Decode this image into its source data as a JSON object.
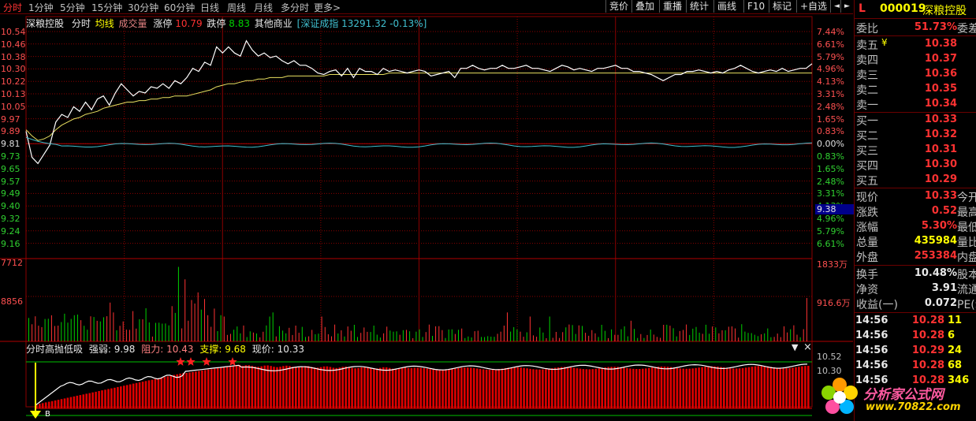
{
  "toolbar": {
    "periods": [
      "分时",
      "1分钟",
      "5分钟",
      "15分钟",
      "30分钟",
      "60分钟",
      "日线",
      "周线",
      "月线",
      "多分时",
      "更多"
    ],
    "more_arrow": ">",
    "buttons": [
      "竞价",
      "叠加",
      "重播",
      "统计",
      "画线",
      "F10",
      "标记",
      "+自选"
    ],
    "scroll_left": "◄",
    "scroll_right": "►"
  },
  "chart_header": {
    "stock": "深粮控股",
    "mode": "分时",
    "avg": "均线",
    "volume": "成交量",
    "limit_up_label": "涨停",
    "limit_up": "10.79",
    "limit_down_label": "跌停",
    "limit_down": "8.83",
    "sector": "其他商业",
    "index": "[深证成指 13291.32 -0.13%]"
  },
  "price_axis": [
    "10.54",
    "10.46",
    "10.38",
    "10.30",
    "10.22",
    "10.13",
    "10.05",
    "9.97",
    "9.89",
    "9.81",
    "9.73",
    "9.65",
    "9.57",
    "9.49",
    "9.40",
    "9.32",
    "9.24",
    "9.16"
  ],
  "pct_axis": [
    "7.44%",
    "6.61%",
    "5.79%",
    "4.96%",
    "4.13%",
    "3.31%",
    "2.48%",
    "1.65%",
    "0.83%",
    "0.00%",
    "0.83%",
    "1.65%",
    "2.48%",
    "3.31%",
    "4.13%",
    "4.96%",
    "5.79%",
    "6.61%"
  ],
  "cursor_price": "9.38",
  "volume_axis": {
    "left_top": "7712",
    "left_mid": "8856",
    "right_top": "1833万",
    "right_mid": "916.6万"
  },
  "indicator": {
    "name": "分时高抛低吸",
    "strength_label": "强弱:",
    "strength": "9.98",
    "resist_label": "阻力:",
    "resist": "10.43",
    "support_label": "支撑:",
    "support": "9.68",
    "price_label": "现价:",
    "price": "10.33",
    "axis_top": "10.52",
    "axis_mid": "10.30",
    "marker": "B",
    "menu": "▼",
    "close": "×"
  },
  "chart_data": {
    "type": "line",
    "series": [
      {
        "values": [
          9.89,
          9.72,
          9.68,
          9.74,
          9.8,
          9.95,
          10.0,
          9.98,
          10.05,
          10.02,
          10.08,
          10.03,
          10.1,
          10.12,
          10.06,
          10.14,
          10.2,
          10.16,
          10.12,
          10.15,
          10.14,
          10.18,
          10.17,
          10.2,
          10.17,
          10.22,
          10.2,
          10.24,
          10.3,
          10.28,
          10.34,
          10.32,
          10.44,
          10.4,
          10.44,
          10.4,
          10.38,
          10.48,
          10.42,
          10.38,
          10.4,
          10.37,
          10.38,
          10.35,
          10.33,
          10.35,
          10.32,
          10.32,
          10.3,
          10.27,
          10.26,
          10.28,
          10.29,
          10.25,
          10.3,
          10.24,
          10.3,
          10.28,
          10.28,
          10.26,
          10.3,
          10.28,
          10.29,
          10.28,
          10.27,
          10.28,
          10.29,
          10.28,
          10.25,
          10.26,
          10.27,
          10.28,
          10.24,
          10.3,
          10.3,
          10.32,
          10.3,
          10.29,
          10.3,
          10.3,
          10.32,
          10.3,
          10.3,
          10.31,
          10.32,
          10.3,
          10.3,
          10.29,
          10.28,
          10.3,
          10.32,
          10.31,
          10.29,
          10.3,
          10.29,
          10.28,
          10.3,
          10.3,
          10.31,
          10.32,
          10.3,
          10.3,
          10.28,
          10.28,
          10.27,
          10.26,
          10.24,
          10.22,
          10.24,
          10.26,
          10.26,
          10.28,
          10.28,
          10.29,
          10.28,
          10.27,
          10.28,
          10.27,
          10.29,
          10.3,
          10.32,
          10.3,
          10.28,
          10.27,
          10.28,
          10.29,
          10.28,
          10.3,
          10.28,
          10.29,
          10.3,
          10.3,
          10.33
        ]
      },
      {
        "values": [
          9.9,
          9.86,
          9.83,
          9.84,
          9.86,
          9.9,
          9.93,
          9.95,
          9.97,
          9.98,
          10.0,
          10.01,
          10.02,
          10.04,
          10.05,
          10.06,
          10.07,
          10.08,
          10.08,
          10.09,
          10.09,
          10.1,
          10.1,
          10.11,
          10.11,
          10.12,
          10.12,
          10.12,
          10.13,
          10.14,
          10.15,
          10.16,
          10.18,
          10.19,
          10.2,
          10.2,
          10.21,
          10.22,
          10.22,
          10.23,
          10.23,
          10.24,
          10.24,
          10.24,
          10.25,
          10.25,
          10.25,
          10.25,
          10.25,
          10.25,
          10.25,
          10.26,
          10.26,
          10.26,
          10.26,
          10.26,
          10.26,
          10.26,
          10.26,
          10.26,
          10.26,
          10.27,
          10.27,
          10.27,
          10.27,
          10.27,
          10.27,
          10.27,
          10.27,
          10.27,
          10.27,
          10.27,
          10.27,
          10.27,
          10.27,
          10.27,
          10.27,
          10.27,
          10.27,
          10.27,
          10.27,
          10.27,
          10.27,
          10.27,
          10.27,
          10.27,
          10.27,
          10.27,
          10.27,
          10.27,
          10.27,
          10.27,
          10.27,
          10.27,
          10.27,
          10.27,
          10.27,
          10.27,
          10.27,
          10.27,
          10.27,
          10.27,
          10.27,
          10.27,
          10.27,
          10.27,
          10.27,
          10.27,
          10.27,
          10.27,
          10.27,
          10.27,
          10.27,
          10.27,
          10.27,
          10.27,
          10.27,
          10.27,
          10.27,
          10.27,
          10.27,
          10.27,
          10.27,
          10.27,
          10.27,
          10.27,
          10.27,
          10.27,
          10.27,
          10.27,
          10.27,
          10.27,
          10.27
        ]
      }
    ],
    "ylim": [
      9.16,
      10.54
    ]
  },
  "panel": {
    "code_prefix": "L",
    "code": "000019",
    "name": "深粮控股",
    "wb_label": "委比",
    "wb": "51.73%",
    "wc_label": "委差",
    "asks": [
      {
        "label": "卖五",
        "price": "10.38"
      },
      {
        "label": "卖四",
        "price": "10.37"
      },
      {
        "label": "卖三",
        "price": "10.36"
      },
      {
        "label": "卖二",
        "price": "10.35"
      },
      {
        "label": "卖一",
        "price": "10.34"
      }
    ],
    "ask_currency": "¥",
    "bids": [
      {
        "label": "买一",
        "price": "10.33"
      },
      {
        "label": "买二",
        "price": "10.32"
      },
      {
        "label": "买三",
        "price": "10.31"
      },
      {
        "label": "买四",
        "price": "10.30"
      },
      {
        "label": "买五",
        "price": "10.29"
      }
    ],
    "quote": [
      {
        "label": "现价",
        "value": "10.33",
        "label2": "今开",
        "color": "red"
      },
      {
        "label": "涨跌",
        "value": "0.52",
        "label2": "最高",
        "color": "red"
      },
      {
        "label": "涨幅",
        "value": "5.30%",
        "label2": "最低",
        "color": "red"
      },
      {
        "label": "总量",
        "value": "435984",
        "label2": "量比",
        "color": "yel"
      },
      {
        "label": "外盘",
        "value": "253384",
        "label2": "内盘",
        "color": "red"
      }
    ],
    "stats": [
      {
        "label": "换手",
        "value": "10.48%",
        "label2": "股本"
      },
      {
        "label": "净资",
        "value": "3.91",
        "label2": "流通"
      },
      {
        "label": "收益(一)",
        "value": "0.072",
        "label2": "PE(动"
      }
    ],
    "ticks": [
      {
        "time": "14:56",
        "price": "10.28",
        "vol": "11"
      },
      {
        "time": "14:56",
        "price": "10.28",
        "vol": "6"
      },
      {
        "time": "14:56",
        "price": "10.29",
        "vol": "24"
      },
      {
        "time": "14:56",
        "price": "10.28",
        "vol": "68"
      },
      {
        "time": "14:56",
        "price": "10.28",
        "vol": "346"
      }
    ]
  },
  "watermark": {
    "line1": "分析家公式网",
    "line2": "www.70822.com"
  }
}
